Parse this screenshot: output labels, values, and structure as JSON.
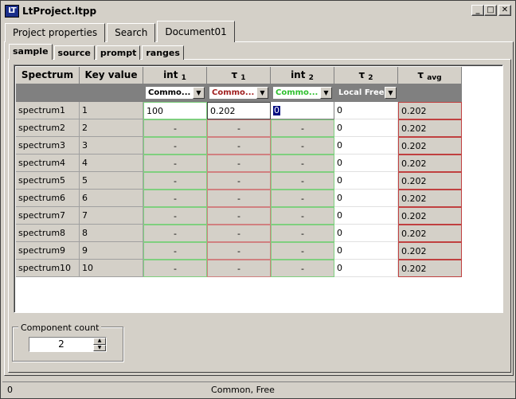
{
  "window": {
    "title": "LtProject.ltpp",
    "icon_text": "LT",
    "minimize_glyph": "_",
    "maximize_glyph": "□",
    "close_glyph": "✕"
  },
  "outer_tabs": [
    "Project properties",
    "Search",
    "Document01"
  ],
  "inner_tabs": [
    "sample",
    "source",
    "prompt",
    "ranges"
  ],
  "grid": {
    "headers": {
      "spectrum": "Spectrum",
      "key": "Key value",
      "int1": "int",
      "int1_sub": "1",
      "tau1": "τ",
      "tau1_sub": "1",
      "int2": "int",
      "int2_sub": "2",
      "tau2": "τ",
      "tau2_sub": "2",
      "tauavg": "τ",
      "tauavg_sub": "avg"
    },
    "combos": {
      "int1": {
        "text": "Commo...",
        "color": "#000000"
      },
      "tau1": {
        "text": "Commo...",
        "color": "#a02020"
      },
      "int2": {
        "text": "Commo...",
        "color": "#30c030"
      },
      "tau2": {
        "text": "Local Free",
        "color": "#ffffff"
      }
    },
    "dropdown_glyph": "▼",
    "rows": [
      {
        "spectrum": "spectrum1",
        "key": "1",
        "int1": "100",
        "tau1": "0.202",
        "int2": "0",
        "tau2": "0",
        "tauavg": "0.202"
      },
      {
        "spectrum": "spectrum2",
        "key": "2",
        "int1": "-",
        "tau1": "-",
        "int2": "-",
        "tau2": "0",
        "tauavg": "0.202"
      },
      {
        "spectrum": "spectrum3",
        "key": "3",
        "int1": "-",
        "tau1": "-",
        "int2": "-",
        "tau2": "0",
        "tauavg": "0.202"
      },
      {
        "spectrum": "spectrum4",
        "key": "4",
        "int1": "-",
        "tau1": "-",
        "int2": "-",
        "tau2": "0",
        "tauavg": "0.202"
      },
      {
        "spectrum": "spectrum5",
        "key": "5",
        "int1": "-",
        "tau1": "-",
        "int2": "-",
        "tau2": "0",
        "tauavg": "0.202"
      },
      {
        "spectrum": "spectrum6",
        "key": "6",
        "int1": "-",
        "tau1": "-",
        "int2": "-",
        "tau2": "0",
        "tauavg": "0.202"
      },
      {
        "spectrum": "spectrum7",
        "key": "7",
        "int1": "-",
        "tau1": "-",
        "int2": "-",
        "tau2": "0",
        "tauavg": "0.202"
      },
      {
        "spectrum": "spectrum8",
        "key": "8",
        "int1": "-",
        "tau1": "-",
        "int2": "-",
        "tau2": "0",
        "tauavg": "0.202"
      },
      {
        "spectrum": "spectrum9",
        "key": "9",
        "int1": "-",
        "tau1": "-",
        "int2": "-",
        "tau2": "0",
        "tauavg": "0.202"
      },
      {
        "spectrum": "spectrum10",
        "key": "10",
        "int1": "-",
        "tau1": "-",
        "int2": "-",
        "tau2": "0",
        "tauavg": "0.202"
      }
    ]
  },
  "component_count": {
    "label": "Component count",
    "value": "2",
    "up_glyph": "▲",
    "down_glyph": "▼"
  },
  "status": {
    "left": "0",
    "center": "Common, Free"
  }
}
